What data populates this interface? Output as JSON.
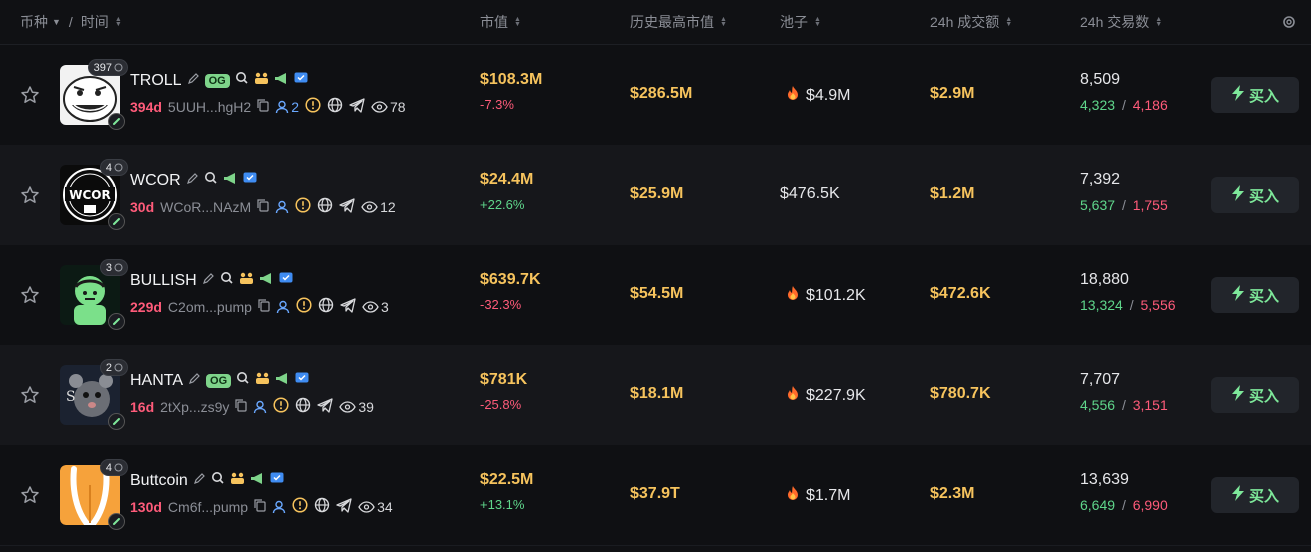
{
  "header": {
    "coin": "币种",
    "sep": "/",
    "time": "时间",
    "mcap": "市值",
    "ath": "历史最高市值",
    "pool": "池子",
    "volume": "24h 成交额",
    "txcount": "24h 交易数"
  },
  "buy_label": "买入",
  "colors": {
    "accent_yellow": "#f6c35d",
    "red": "#ff5b7a",
    "green": "#5fd68b",
    "og": "#7ed48a"
  },
  "rows": [
    {
      "name": "TROLL",
      "og": "OG",
      "holders": "397",
      "age": "394d",
      "addr": "5UUH...hgH2",
      "devs": "2",
      "views": "78",
      "mcap": "$108.3M",
      "change": "-7.3%",
      "ath": "$286.5M",
      "pool": "$4.9M",
      "pool_hot": true,
      "volume": "$2.9M",
      "tx": "8,509",
      "buys": "4,323",
      "slash": "/",
      "sells": "4,186"
    },
    {
      "name": "WCOR",
      "og": "",
      "holders": "4",
      "age": "30d",
      "addr": "WCoR...NAzM",
      "devs": "",
      "views": "12",
      "mcap": "$24.4M",
      "change": "+22.6%",
      "ath": "$25.9M",
      "pool": "$476.5K",
      "pool_hot": false,
      "volume": "$1.2M",
      "tx": "7,392",
      "buys": "5,637",
      "slash": "/",
      "sells": "1,755"
    },
    {
      "name": "BULLISH",
      "og": "",
      "holders": "3",
      "age": "229d",
      "addr": "C2om...pump",
      "devs": "",
      "views": "3",
      "mcap": "$639.7K",
      "change": "-32.3%",
      "ath": "$54.5M",
      "pool": "$101.2K",
      "pool_hot": true,
      "volume": "$472.6K",
      "tx": "18,880",
      "buys": "13,324",
      "slash": "/",
      "sells": "5,556"
    },
    {
      "name": "HANTA",
      "og": "OG",
      "holders": "2",
      "age": "16d",
      "addr": "2tXp...zs9y",
      "devs": "",
      "views": "39",
      "mcap": "$781K",
      "change": "-25.8%",
      "ath": "$18.1M",
      "pool": "$227.9K",
      "pool_hot": true,
      "volume": "$780.7K",
      "tx": "7,707",
      "buys": "4,556",
      "slash": "/",
      "sells": "3,151"
    },
    {
      "name": "Buttcoin",
      "og": "",
      "holders": "4",
      "age": "130d",
      "addr": "Cm6f...pump",
      "devs": "",
      "views": "34",
      "mcap": "$22.5M",
      "change": "+13.1%",
      "ath": "$37.9T",
      "pool": "$1.7M",
      "pool_hot": true,
      "volume": "$2.3M",
      "tx": "13,639",
      "buys": "6,649",
      "slash": "/",
      "sells": "6,990"
    }
  ]
}
